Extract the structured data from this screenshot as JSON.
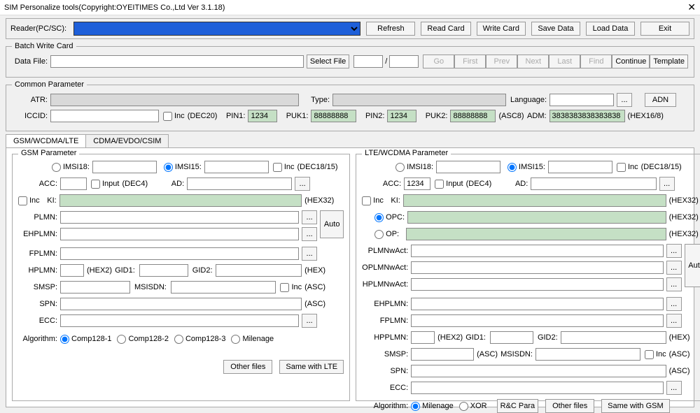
{
  "title": "SIM Personalize tools(Copyright:OYEITIMES Co.,Ltd Ver 3.1.18)",
  "reader": {
    "label": "Reader(PC/SC):"
  },
  "topbtn": {
    "refresh": "Refresh",
    "read": "Read Card",
    "write": "Write Card",
    "save": "Save Data",
    "load": "Load Data",
    "exit": "Exit"
  },
  "batch": {
    "legend": "Batch Write Card",
    "datafile": "Data File:",
    "select": "Select File",
    "slash": "/",
    "go": "Go",
    "first": "First",
    "prev": "Prev",
    "next": "Next",
    "last": "Last",
    "find": "Find",
    "continue": "Continue",
    "template": "Template"
  },
  "common": {
    "legend": "Common Parameter",
    "atr": "ATR:",
    "type": "Type:",
    "language": "Language:",
    "adn": "ADN",
    "iccid": "ICCID:",
    "inc": "Inc",
    "dec20": "(DEC20)",
    "pin1": "PIN1:",
    "pin1v": "1234",
    "puk1": "PUK1:",
    "puk1v": "88888888",
    "pin2": "PIN2:",
    "pin2v": "1234",
    "puk2": "PUK2:",
    "puk2v": "88888888",
    "asc8": "(ASC8)",
    "adm": "ADM:",
    "admv": "3838383838383838",
    "hex168": "(HEX16/8)",
    "dots": "..."
  },
  "tabs": {
    "t1": "GSM/WCDMA/LTE",
    "t2": "CDMA/EVDO/CSIM"
  },
  "gsm": {
    "legend": "GSM Parameter",
    "imsi18": "IMSI18:",
    "imsi15": "IMSI15:",
    "inc": "Inc",
    "dec1815": "(DEC18/15)",
    "acc": "ACC:",
    "input": "Input",
    "dec4": "(DEC4)",
    "ad": "AD:",
    "dots": "...",
    "ki": "KI:",
    "hex32": "(HEX32)",
    "plmn": "PLMN:",
    "ehplmn": "EHPLMN:",
    "fplmn": "FPLMN:",
    "auto": "Auto",
    "hplmn": "HPLMN:",
    "hex2": "(HEX2)",
    "gid1": "GID1:",
    "gid2": "GID2:",
    "hex": "(HEX)",
    "smsp": "SMSP:",
    "msisdn": "MSISDN:",
    "asc": "(ASC)",
    "spn": "SPN:",
    "ecc": "ECC:",
    "algo": "Algorithm:",
    "c1": "Comp128-1",
    "c2": "Comp128-2",
    "c3": "Comp128-3",
    "mile": "Milenage",
    "other": "Other files",
    "samelte": "Same with LTE"
  },
  "lte": {
    "legend": "LTE/WCDMA Parameter",
    "imsi18": "IMSI18:",
    "imsi15": "IMSI15:",
    "inc": "Inc",
    "dec1815": "(DEC18/15)",
    "acc": "ACC:",
    "accv": "1234",
    "input": "Input",
    "dec4": "(DEC4)",
    "ad": "AD:",
    "dots": "...",
    "ki": "KI:",
    "hex32": "(HEX32)",
    "opc": "OPC:",
    "op": "OP:",
    "plmnwact": "PLMNwAct:",
    "oplmnwact": "OPLMNwAct:",
    "hplmnwact": "HPLMNwAct:",
    "auto": "Auto",
    "ehplmn": "EHPLMN:",
    "fplmn": "FPLMN:",
    "hpplmn": "HPPLMN:",
    "hex2": "(HEX2)",
    "gid1": "GID1:",
    "gid2": "GID2:",
    "hex": "(HEX)",
    "smsp": "SMSP:",
    "asc": "(ASC)",
    "msisdn": "MSISDN:",
    "spn": "SPN:",
    "ecc": "ECC:",
    "algo": "Algorithm:",
    "mile": "Milenage",
    "xor": "XOR",
    "rcpara": "R&C Para",
    "other": "Other files",
    "samegsm": "Same with GSM"
  }
}
